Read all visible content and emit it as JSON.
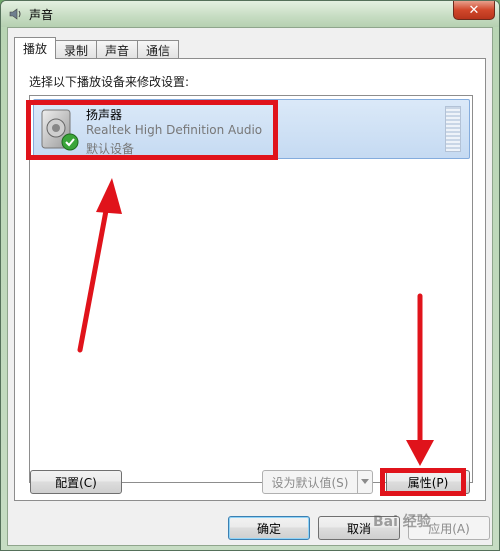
{
  "window": {
    "title": "声音",
    "close_label": "✕"
  },
  "tabs": [
    {
      "label": "播放",
      "active": true
    },
    {
      "label": "录制",
      "active": false
    },
    {
      "label": "声音",
      "active": false
    },
    {
      "label": "通信",
      "active": false
    }
  ],
  "panel": {
    "instruction": "选择以下播放设备来修改设置:",
    "device": {
      "name": "扬声器",
      "description": "Realtek High Definition Audio",
      "status": "默认设备"
    }
  },
  "buttons": {
    "configure": "配置(C)",
    "set_default": "设为默认值(S)",
    "properties": "属性(P)",
    "ok": "确定",
    "cancel": "取消",
    "apply": "应用(A)"
  },
  "watermark": "Bai 经验",
  "colors": {
    "annotation": "#e0131b",
    "selection": "#c5daf2",
    "titlebar": "#c6dcc2"
  }
}
